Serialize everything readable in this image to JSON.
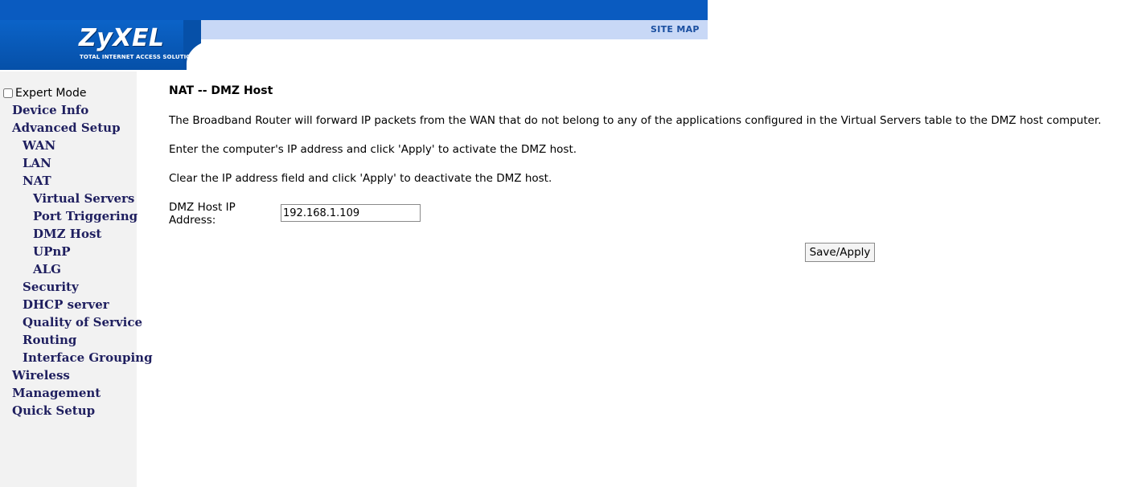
{
  "header": {
    "brand": "ZyXEL",
    "tagline": "Total Internet Access Solution",
    "site_map_label": "SITE MAP"
  },
  "sidebar": {
    "expert_mode_label": "Expert Mode",
    "expert_mode_checked": false,
    "items": [
      {
        "label": "Device Info"
      },
      {
        "label": "Advanced Setup"
      },
      {
        "label": "WAN"
      },
      {
        "label": "LAN"
      },
      {
        "label": "NAT"
      },
      {
        "label": "Virtual Servers"
      },
      {
        "label": "Port Triggering"
      },
      {
        "label": "DMZ Host"
      },
      {
        "label": "UPnP"
      },
      {
        "label": "ALG"
      },
      {
        "label": "Security"
      },
      {
        "label": "DHCP server"
      },
      {
        "label": "Quality of Service"
      },
      {
        "label": "Routing"
      },
      {
        "label": "Interface Grouping"
      },
      {
        "label": "Wireless"
      },
      {
        "label": "Management"
      },
      {
        "label": "Quick Setup"
      }
    ]
  },
  "main": {
    "title": "NAT -- DMZ Host",
    "paragraphs": [
      "The Broadband Router will forward IP packets from the WAN that do not belong to any of the applications configured in the Virtual Servers table to the DMZ host computer.",
      "Enter the computer's IP address and click 'Apply' to activate the DMZ host.",
      "Clear the IP address field and click 'Apply' to deactivate the DMZ host."
    ],
    "ip_label": "DMZ Host IP Address:",
    "ip_value": "192.168.1.109",
    "save_label": "Save/Apply"
  },
  "colors": {
    "header_blue": "#0a5bc0",
    "header_light": "#c8d8f6",
    "sidebar_bg": "#f2f2f2",
    "nav_text": "#1f1f5f"
  }
}
